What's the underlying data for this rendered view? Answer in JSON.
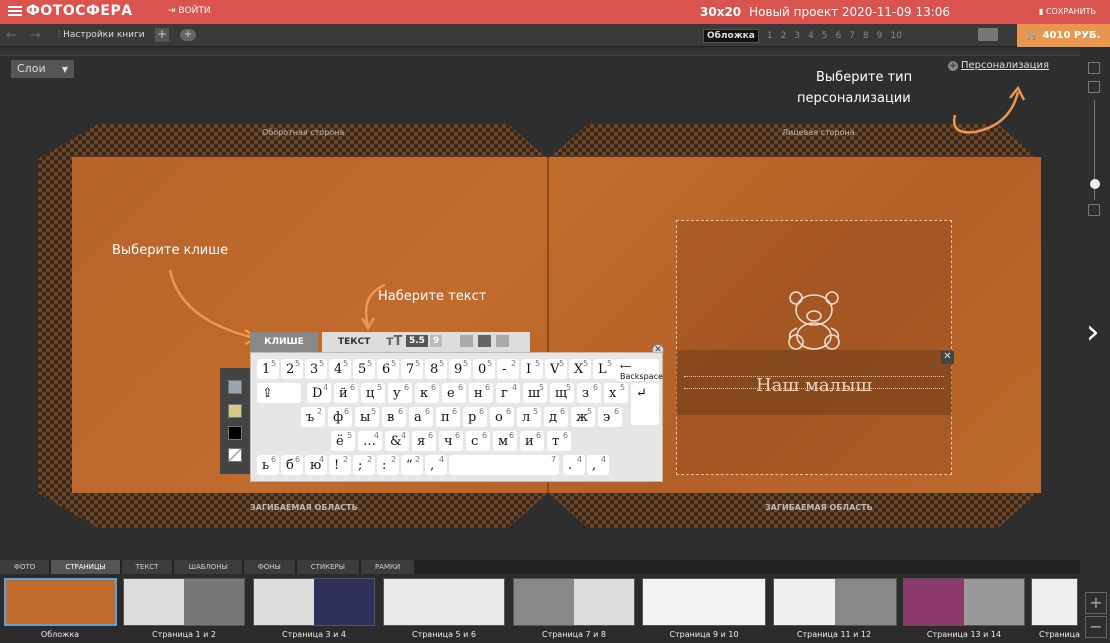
{
  "header": {
    "logo": "ФОТОСФЕРА",
    "login": "ВОЙТИ",
    "size": "30x20",
    "project": "Новый проект 2020-11-09 13:06",
    "save": "СОХРАНИТЬ",
    "accent": "#d9534f"
  },
  "toolbar": {
    "settings": "Настройки книги",
    "pages_current": "Обложка",
    "pages": [
      "1",
      "2",
      "3",
      "4",
      "5",
      "6",
      "7",
      "8",
      "9",
      "10"
    ],
    "price": "4010 РУБ."
  },
  "editor": {
    "layers": "Слои",
    "back_side": "Оборотная сторона",
    "front_side": "Лицевая сторона",
    "fold_left": "ЗАГИБАЕМАЯ ОБЛАСТЬ",
    "fold_right": "ЗАГИБАЕМАЯ ОБЛАСТЬ",
    "personalization": "Персонализация",
    "hint_type_1": "Выберите тип",
    "hint_type_2": "персонализации",
    "hint_klishe": "Выберите клише",
    "hint_text": "Наберите текст",
    "cliche_text": "Наш малыш"
  },
  "keyboard": {
    "tab_klishe": "КЛИШЕ",
    "tab_text": "ТЕКСТ",
    "size_icon": "тT",
    "size_a": "5.5",
    "size_b": "9",
    "backspace": "Backspace",
    "row1": [
      [
        "1",
        "5"
      ],
      [
        "2",
        "5"
      ],
      [
        "3",
        "5"
      ],
      [
        "4",
        "5"
      ],
      [
        "5",
        "5"
      ],
      [
        "6",
        "5"
      ],
      [
        "7",
        "5"
      ],
      [
        "8",
        "5"
      ],
      [
        "9",
        "5"
      ],
      [
        "0",
        "5"
      ],
      [
        "-",
        "2"
      ],
      [
        "I",
        "5"
      ],
      [
        "V",
        "5"
      ],
      [
        "X",
        "5"
      ],
      [
        "L",
        "5"
      ]
    ],
    "row2": [
      [
        "D",
        "4"
      ],
      [
        "й",
        "6"
      ],
      [
        "ц",
        "5"
      ],
      [
        "у",
        "6"
      ],
      [
        "к",
        "6"
      ],
      [
        "е",
        "6"
      ],
      [
        "н",
        "6"
      ],
      [
        "г",
        "4"
      ],
      [
        "ш",
        "5"
      ],
      [
        "щ",
        "5"
      ],
      [
        "з",
        "6"
      ],
      [
        "х",
        "5"
      ]
    ],
    "row3": [
      [
        "ъ",
        "2"
      ],
      [
        "ф",
        "6"
      ],
      [
        "ы",
        "5"
      ],
      [
        "в",
        "6"
      ],
      [
        "а",
        "6"
      ],
      [
        "п",
        "6"
      ],
      [
        "р",
        "6"
      ],
      [
        "о",
        "6"
      ],
      [
        "л",
        "5"
      ],
      [
        "д",
        "6"
      ],
      [
        "ж",
        "5"
      ],
      [
        "э",
        "6"
      ]
    ],
    "row4": [
      [
        "ё",
        "5"
      ],
      [
        "…",
        "4"
      ],
      [
        "&",
        "4"
      ],
      [
        "я",
        "6"
      ],
      [
        "ч",
        "6"
      ],
      [
        "с",
        "6"
      ],
      [
        "м",
        "6"
      ],
      [
        "и",
        "6"
      ],
      [
        "т",
        "6"
      ]
    ],
    "row5": [
      [
        "ь",
        "6"
      ],
      [
        "б",
        "6"
      ],
      [
        "ю",
        "4"
      ],
      [
        "!",
        "2"
      ],
      [
        ";",
        "2"
      ],
      [
        ":",
        "2"
      ],
      [
        "“",
        "2"
      ],
      [
        "‚",
        "4"
      ],
      [
        "",
        "7"
      ],
      [
        ".",
        "4"
      ],
      [
        ",",
        "4"
      ]
    ]
  },
  "bottom": {
    "tabs": [
      "ФОТО",
      "СТРАНИЦЫ",
      "ТЕКСТ",
      "ШАБЛОНЫ",
      "ФОНЫ",
      "СТИКЕРЫ",
      "РАМКИ"
    ],
    "active_tab": "СТРАНИЦЫ",
    "thumbs": [
      "Обложка",
      "Страница 1 и 2",
      "Страница 3 и 4",
      "Страница 5 и 6",
      "Страница 7 и 8",
      "Страница 9 и 10",
      "Страница 11 и 12",
      "Страница 13 и 14",
      "Страница"
    ]
  }
}
